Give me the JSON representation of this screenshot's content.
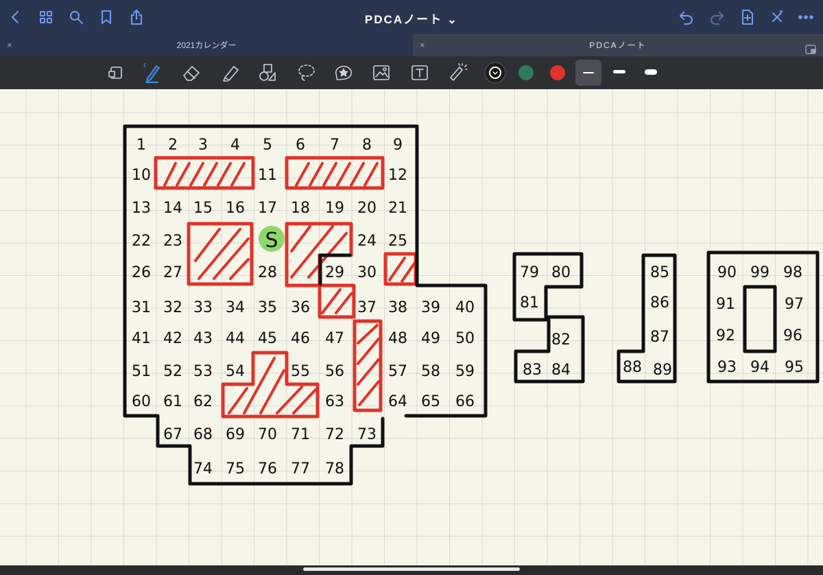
{
  "nav": {
    "title": "PDCAノート ⌄",
    "icons": [
      "back-icon",
      "grid-icon",
      "search-icon",
      "bookmark-icon",
      "share-icon",
      "undo-icon",
      "redo-icon",
      "add-page-icon",
      "close-x-icon",
      "more-icon"
    ]
  },
  "tabs": [
    {
      "label": "2021カレンダー",
      "close": "×"
    },
    {
      "label": "PDCAノート",
      "close": "×"
    }
  ],
  "toolbar": {
    "tools": [
      "zoom-window-tool",
      "pen-tool",
      "eraser-tool",
      "highlighter-tool",
      "shapes-tool",
      "lasso-tool",
      "elements-tool",
      "image-tool",
      "text-tool",
      "laser-pointer-tool"
    ],
    "colors": [
      "#111111",
      "#2f7a58",
      "#e0342a"
    ],
    "selected_color": "#111111"
  },
  "canvas": {
    "start_label": "S",
    "main_grid": [
      [
        "1",
        "2",
        "3",
        "4",
        "5",
        "6",
        "7",
        "8",
        "9"
      ],
      [
        "10",
        "",
        "",
        "",
        "11",
        "",
        "",
        "",
        "12"
      ],
      [
        "13",
        "14",
        "15",
        "16",
        "17",
        "18",
        "19",
        "20",
        "21"
      ],
      [
        "22",
        "23",
        "",
        "",
        "",
        "",
        "",
        "24",
        "25"
      ],
      [
        "26",
        "27",
        "",
        "",
        "28",
        "",
        "29",
        "30",
        ""
      ],
      [
        "31",
        "32",
        "33",
        "34",
        "35",
        "36",
        "",
        "37",
        "38",
        "39",
        "40"
      ],
      [
        "41",
        "42",
        "43",
        "44",
        "45",
        "46",
        "47",
        "",
        "48",
        "49",
        "50"
      ],
      [
        "51",
        "52",
        "53",
        "54",
        "",
        "55",
        "56",
        "",
        "57",
        "58",
        "59"
      ],
      [
        "60",
        "61",
        "62",
        "",
        "",
        "",
        "63",
        "",
        "64",
        "65",
        "66"
      ],
      [
        "",
        "67",
        "68",
        "69",
        "70",
        "71",
        "72",
        "73"
      ],
      [
        "",
        "",
        "74",
        "75",
        "76",
        "77",
        "78"
      ]
    ],
    "block_s": [
      "79",
      "80",
      "81",
      "82",
      "83",
      "84"
    ],
    "block_j": [
      "85",
      "86",
      "87",
      "88",
      "89"
    ],
    "block_o": [
      "90",
      "99",
      "98",
      "91",
      "97",
      "92",
      "96",
      "93",
      "94",
      "95"
    ]
  }
}
